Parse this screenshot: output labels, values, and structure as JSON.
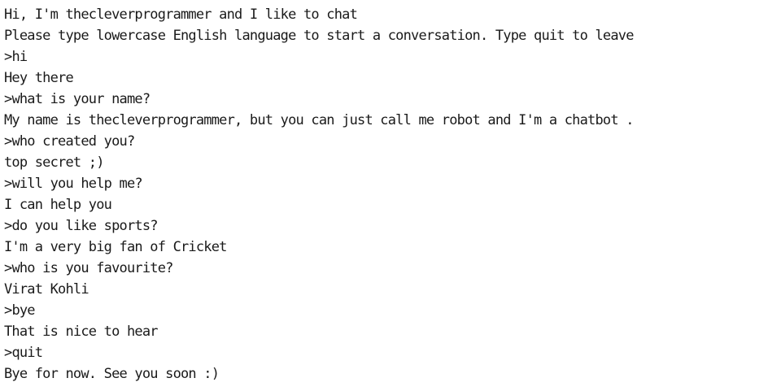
{
  "console": {
    "banner": "Hi, I'm thecleverprogrammer and I like to chat",
    "instructions": "Please type lowercase English language to start a conversation. Type quit to leave",
    "prompt_symbol": ">",
    "conversation": [
      {
        "user": "hi",
        "bot": "Hey there"
      },
      {
        "user": "what is your name?",
        "bot": "My name is thecleverprogrammer, but you can just call me robot and I'm a chatbot ."
      },
      {
        "user": "who created you?",
        "bot": "top secret ;)"
      },
      {
        "user": "will you help me?",
        "bot": "I can help you"
      },
      {
        "user": "do you like sports?",
        "bot": "I'm a very big fan of Cricket"
      },
      {
        "user": "who is you favourite?",
        "bot": "Virat Kohli"
      },
      {
        "user": "bye",
        "bot": "That is nice to hear"
      },
      {
        "user": "quit",
        "bot": "Bye for now. See you soon :)"
      }
    ]
  }
}
